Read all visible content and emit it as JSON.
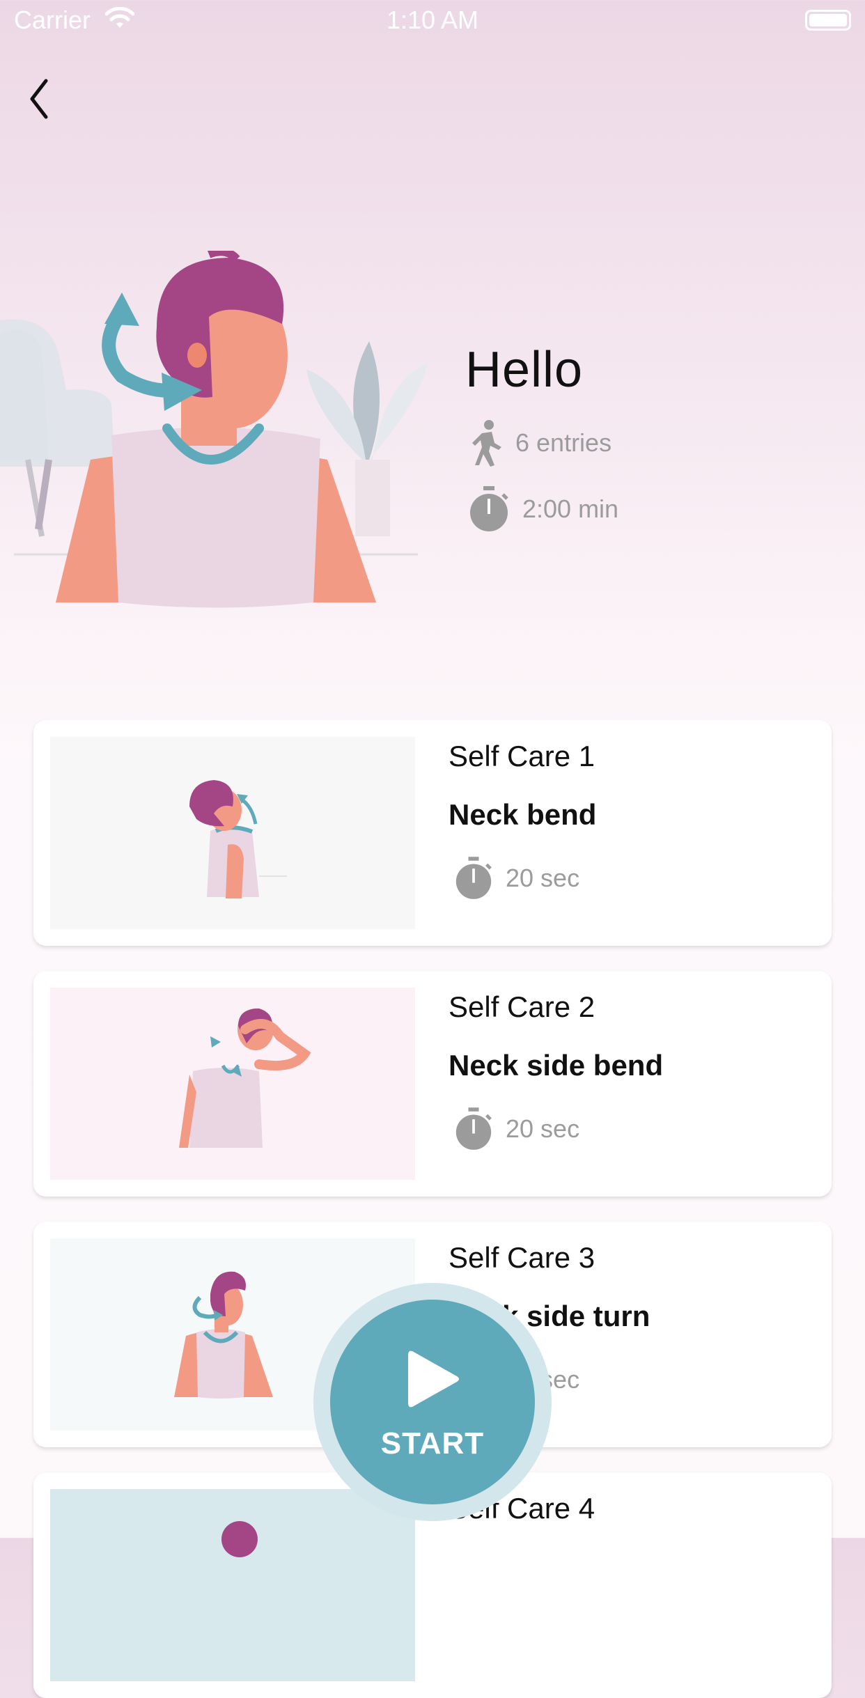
{
  "status_bar": {
    "carrier": "Carrier",
    "time": "1:10 AM"
  },
  "header": {
    "back_icon": "chevron-left-icon"
  },
  "hero": {
    "title": "Hello",
    "entries": "6 entries",
    "duration": "2:00 min",
    "entries_icon": "walking-person-icon",
    "duration_icon": "stopwatch-icon"
  },
  "exercises": [
    {
      "subtitle": "Self Care 1",
      "title": "Neck bend",
      "time": "20 sec"
    },
    {
      "subtitle": "Self Care 2",
      "title": "Neck side bend",
      "time": "20 sec"
    },
    {
      "subtitle": "Self Care 3",
      "title": "Neck side turn",
      "time": "20 sec"
    },
    {
      "subtitle": "Self Care 4",
      "title": "",
      "time": ""
    }
  ],
  "start_button": {
    "label": "START",
    "icon": "play-icon"
  },
  "colors": {
    "accent": "#5ea9ba",
    "accent_ring": "#d3e6ec",
    "hair": "#a44686",
    "skin": "#f29a84",
    "shirt": "#ead6e3",
    "muted_text": "#9b9b9b",
    "thumb1_bg": "#f7f7f7",
    "thumb2_bg": "#fcf1f6",
    "thumb3_bg": "#f5f9fa",
    "thumb4_bg": "#d8e9ee"
  }
}
